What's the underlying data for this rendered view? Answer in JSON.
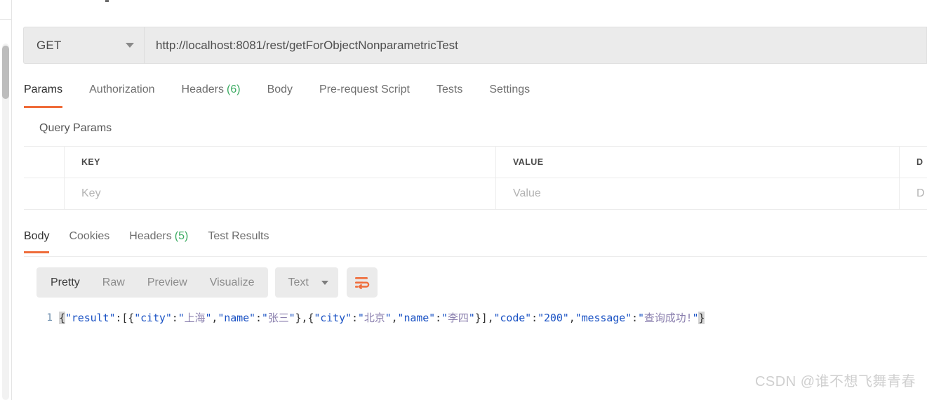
{
  "request": {
    "method": "GET",
    "url": "http://localhost:8081/rest/getForObjectNonparametricTest",
    "tabs": [
      {
        "label": "Params",
        "count": "",
        "active": true
      },
      {
        "label": "Authorization",
        "count": "",
        "active": false
      },
      {
        "label": "Headers",
        "count": "(6)",
        "active": false
      },
      {
        "label": "Body",
        "count": "",
        "active": false
      },
      {
        "label": "Pre-request Script",
        "count": "",
        "active": false
      },
      {
        "label": "Tests",
        "count": "",
        "active": false
      },
      {
        "label": "Settings",
        "count": "",
        "active": false
      }
    ]
  },
  "query_params": {
    "section_title": "Query Params",
    "headers": {
      "key": "KEY",
      "value": "VALUE",
      "description": "D"
    },
    "rows": [
      {
        "key": "Key",
        "value": "Value",
        "description": "D"
      }
    ]
  },
  "response": {
    "tabs": [
      {
        "label": "Body",
        "count": "",
        "active": true
      },
      {
        "label": "Cookies",
        "count": "",
        "active": false
      },
      {
        "label": "Headers",
        "count": "(5)",
        "active": false
      },
      {
        "label": "Test Results",
        "count": "",
        "active": false
      }
    ],
    "format_tabs": [
      {
        "label": "Pretty",
        "active": true
      },
      {
        "label": "Raw",
        "active": false
      },
      {
        "label": "Preview",
        "active": false
      },
      {
        "label": "Visualize",
        "active": false
      }
    ],
    "content_type": "Text",
    "wrap_icon": "word-wrap-icon",
    "body": {
      "line_number": "1",
      "raw": "{\"result\":[{\"city\":\"上海\",\"name\":\"张三\"},{\"city\":\"北京\",\"name\":\"李四\"}],\"code\":\"200\",\"message\":\"查询成功!\"}",
      "tokens": [
        {
          "t": "{",
          "c": "brace-hl"
        },
        {
          "t": "\"result\"",
          "c": "str"
        },
        {
          "t": ":[{",
          "c": "punct"
        },
        {
          "t": "\"city\"",
          "c": "str"
        },
        {
          "t": ":",
          "c": "punct"
        },
        {
          "t": "\"",
          "c": "str"
        },
        {
          "t": "上海",
          "c": "cjk"
        },
        {
          "t": "\"",
          "c": "str"
        },
        {
          "t": ",",
          "c": "punct"
        },
        {
          "t": "\"name\"",
          "c": "str"
        },
        {
          "t": ":",
          "c": "punct"
        },
        {
          "t": "\"",
          "c": "str"
        },
        {
          "t": "张三",
          "c": "cjk"
        },
        {
          "t": "\"",
          "c": "str"
        },
        {
          "t": "},{",
          "c": "punct"
        },
        {
          "t": "\"city\"",
          "c": "str"
        },
        {
          "t": ":",
          "c": "punct"
        },
        {
          "t": "\"",
          "c": "str"
        },
        {
          "t": "北京",
          "c": "cjk"
        },
        {
          "t": "\"",
          "c": "str"
        },
        {
          "t": ",",
          "c": "punct"
        },
        {
          "t": "\"name\"",
          "c": "str"
        },
        {
          "t": ":",
          "c": "punct"
        },
        {
          "t": "\"",
          "c": "str"
        },
        {
          "t": "李四",
          "c": "cjk"
        },
        {
          "t": "\"",
          "c": "str"
        },
        {
          "t": "}],",
          "c": "punct"
        },
        {
          "t": "\"code\"",
          "c": "str"
        },
        {
          "t": ":",
          "c": "punct"
        },
        {
          "t": "\"200\"",
          "c": "str"
        },
        {
          "t": ",",
          "c": "punct"
        },
        {
          "t": "\"message\"",
          "c": "str"
        },
        {
          "t": ":",
          "c": "punct"
        },
        {
          "t": "\"",
          "c": "str"
        },
        {
          "t": "查询成功!",
          "c": "cjk"
        },
        {
          "t": "\"",
          "c": "str"
        },
        {
          "t": "}",
          "c": "brace-hl"
        }
      ]
    }
  },
  "watermark": "CSDN @谁不想飞舞青春",
  "colors": {
    "accent": "#ef6c3a",
    "count_green": "#3bab61",
    "string_blue": "#1a52c4",
    "cjk_purple": "#8a7fae",
    "toolbar_gray": "#ebebeb"
  }
}
